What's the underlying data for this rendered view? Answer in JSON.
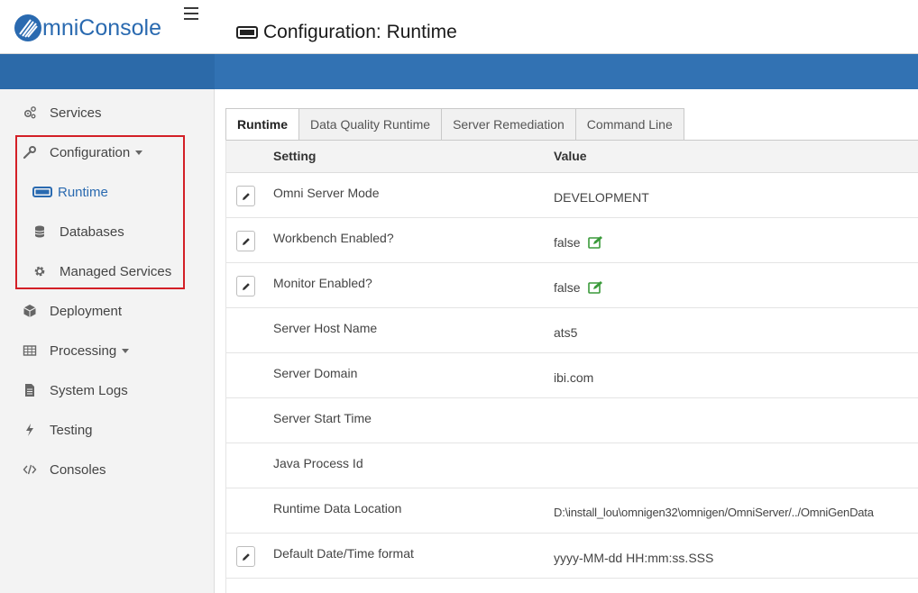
{
  "app": {
    "brand_first": "O",
    "brand_rest": "mniConsole",
    "brand_color": "#2a6ab0",
    "accent_color": "#3272b3"
  },
  "header": {
    "title": "Configuration: Runtime"
  },
  "sidebar": {
    "items": [
      {
        "label": "Services",
        "icon": "cogs-icon"
      },
      {
        "label": "Configuration",
        "icon": "wrench-icon"
      },
      {
        "label": "Runtime",
        "icon": "monitor-icon"
      },
      {
        "label": "Databases",
        "icon": "database-icon"
      },
      {
        "label": "Managed Services",
        "icon": "gear-icon"
      },
      {
        "label": "Deployment",
        "icon": "cube-icon"
      },
      {
        "label": "Processing",
        "icon": "table-icon"
      },
      {
        "label": "System Logs",
        "icon": "file-icon"
      },
      {
        "label": "Testing",
        "icon": "bolt-icon"
      },
      {
        "label": "Consoles",
        "icon": "code-icon"
      }
    ]
  },
  "tabs": [
    "Runtime",
    "Data Quality Runtime",
    "Server Remediation",
    "Command Line"
  ],
  "table": {
    "headers": {
      "setting": "Setting",
      "value": "Value"
    },
    "rows": [
      {
        "setting": "Omni Server Mode",
        "value": "DEVELOPMENT"
      },
      {
        "setting": "Workbench Enabled?",
        "value": "false"
      },
      {
        "setting": "Monitor Enabled?",
        "value": "false"
      },
      {
        "setting": "Server Host Name",
        "value": "ats5"
      },
      {
        "setting": "Server Domain",
        "value": "ibi.com"
      },
      {
        "setting": "Server Start Time",
        "value": ""
      },
      {
        "setting": "Java Process Id",
        "value": ""
      },
      {
        "setting": "Runtime Data Location",
        "value": "D:\\install_lou\\omnigen32\\omnigen/OmniServer/../OmniGenData"
      },
      {
        "setting": "Default Date/Time format",
        "value": "yyyy-MM-dd HH:mm:ss.SSS"
      }
    ]
  }
}
